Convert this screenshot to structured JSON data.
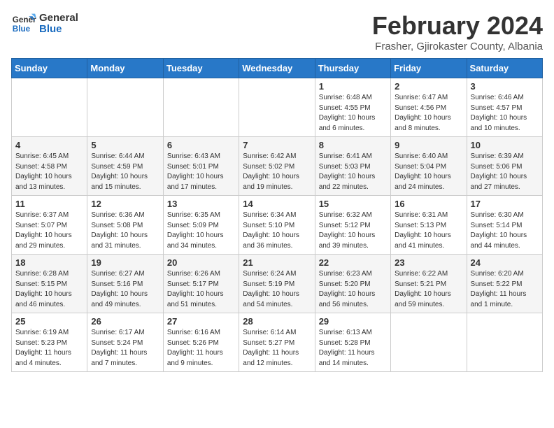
{
  "logo": {
    "line1": "General",
    "line2": "Blue"
  },
  "title": "February 2024",
  "subtitle": "Frasher, Gjirokaster County, Albania",
  "weekdays": [
    "Sunday",
    "Monday",
    "Tuesday",
    "Wednesday",
    "Thursday",
    "Friday",
    "Saturday"
  ],
  "weeks": [
    [
      {
        "day": "",
        "info": ""
      },
      {
        "day": "",
        "info": ""
      },
      {
        "day": "",
        "info": ""
      },
      {
        "day": "",
        "info": ""
      },
      {
        "day": "1",
        "info": "Sunrise: 6:48 AM\nSunset: 4:55 PM\nDaylight: 10 hours\nand 6 minutes."
      },
      {
        "day": "2",
        "info": "Sunrise: 6:47 AM\nSunset: 4:56 PM\nDaylight: 10 hours\nand 8 minutes."
      },
      {
        "day": "3",
        "info": "Sunrise: 6:46 AM\nSunset: 4:57 PM\nDaylight: 10 hours\nand 10 minutes."
      }
    ],
    [
      {
        "day": "4",
        "info": "Sunrise: 6:45 AM\nSunset: 4:58 PM\nDaylight: 10 hours\nand 13 minutes."
      },
      {
        "day": "5",
        "info": "Sunrise: 6:44 AM\nSunset: 4:59 PM\nDaylight: 10 hours\nand 15 minutes."
      },
      {
        "day": "6",
        "info": "Sunrise: 6:43 AM\nSunset: 5:01 PM\nDaylight: 10 hours\nand 17 minutes."
      },
      {
        "day": "7",
        "info": "Sunrise: 6:42 AM\nSunset: 5:02 PM\nDaylight: 10 hours\nand 19 minutes."
      },
      {
        "day": "8",
        "info": "Sunrise: 6:41 AM\nSunset: 5:03 PM\nDaylight: 10 hours\nand 22 minutes."
      },
      {
        "day": "9",
        "info": "Sunrise: 6:40 AM\nSunset: 5:04 PM\nDaylight: 10 hours\nand 24 minutes."
      },
      {
        "day": "10",
        "info": "Sunrise: 6:39 AM\nSunset: 5:06 PM\nDaylight: 10 hours\nand 27 minutes."
      }
    ],
    [
      {
        "day": "11",
        "info": "Sunrise: 6:37 AM\nSunset: 5:07 PM\nDaylight: 10 hours\nand 29 minutes."
      },
      {
        "day": "12",
        "info": "Sunrise: 6:36 AM\nSunset: 5:08 PM\nDaylight: 10 hours\nand 31 minutes."
      },
      {
        "day": "13",
        "info": "Sunrise: 6:35 AM\nSunset: 5:09 PM\nDaylight: 10 hours\nand 34 minutes."
      },
      {
        "day": "14",
        "info": "Sunrise: 6:34 AM\nSunset: 5:10 PM\nDaylight: 10 hours\nand 36 minutes."
      },
      {
        "day": "15",
        "info": "Sunrise: 6:32 AM\nSunset: 5:12 PM\nDaylight: 10 hours\nand 39 minutes."
      },
      {
        "day": "16",
        "info": "Sunrise: 6:31 AM\nSunset: 5:13 PM\nDaylight: 10 hours\nand 41 minutes."
      },
      {
        "day": "17",
        "info": "Sunrise: 6:30 AM\nSunset: 5:14 PM\nDaylight: 10 hours\nand 44 minutes."
      }
    ],
    [
      {
        "day": "18",
        "info": "Sunrise: 6:28 AM\nSunset: 5:15 PM\nDaylight: 10 hours\nand 46 minutes."
      },
      {
        "day": "19",
        "info": "Sunrise: 6:27 AM\nSunset: 5:16 PM\nDaylight: 10 hours\nand 49 minutes."
      },
      {
        "day": "20",
        "info": "Sunrise: 6:26 AM\nSunset: 5:17 PM\nDaylight: 10 hours\nand 51 minutes."
      },
      {
        "day": "21",
        "info": "Sunrise: 6:24 AM\nSunset: 5:19 PM\nDaylight: 10 hours\nand 54 minutes."
      },
      {
        "day": "22",
        "info": "Sunrise: 6:23 AM\nSunset: 5:20 PM\nDaylight: 10 hours\nand 56 minutes."
      },
      {
        "day": "23",
        "info": "Sunrise: 6:22 AM\nSunset: 5:21 PM\nDaylight: 10 hours\nand 59 minutes."
      },
      {
        "day": "24",
        "info": "Sunrise: 6:20 AM\nSunset: 5:22 PM\nDaylight: 11 hours\nand 1 minute."
      }
    ],
    [
      {
        "day": "25",
        "info": "Sunrise: 6:19 AM\nSunset: 5:23 PM\nDaylight: 11 hours\nand 4 minutes."
      },
      {
        "day": "26",
        "info": "Sunrise: 6:17 AM\nSunset: 5:24 PM\nDaylight: 11 hours\nand 7 minutes."
      },
      {
        "day": "27",
        "info": "Sunrise: 6:16 AM\nSunset: 5:26 PM\nDaylight: 11 hours\nand 9 minutes."
      },
      {
        "day": "28",
        "info": "Sunrise: 6:14 AM\nSunset: 5:27 PM\nDaylight: 11 hours\nand 12 minutes."
      },
      {
        "day": "29",
        "info": "Sunrise: 6:13 AM\nSunset: 5:28 PM\nDaylight: 11 hours\nand 14 minutes."
      },
      {
        "day": "",
        "info": ""
      },
      {
        "day": "",
        "info": ""
      }
    ]
  ]
}
